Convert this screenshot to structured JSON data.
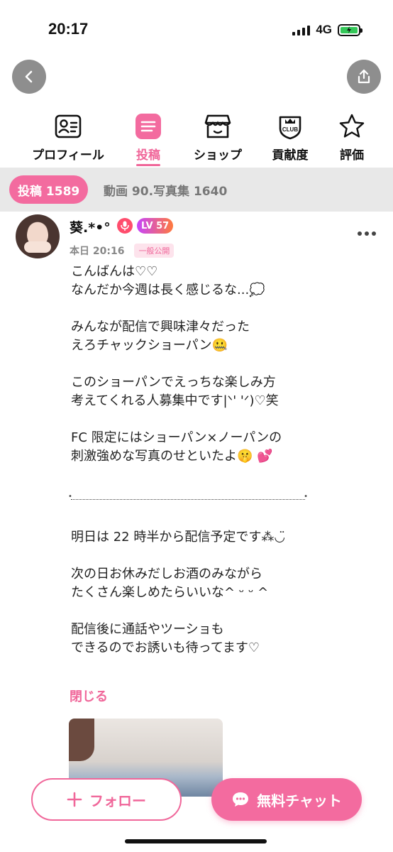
{
  "status_bar": {
    "time": "20:17",
    "network": "4G"
  },
  "tabs": [
    {
      "label": "プロフィール",
      "icon": "profile-card-icon"
    },
    {
      "label": "投稿",
      "icon": "posts-icon",
      "active": true
    },
    {
      "label": "ショップ",
      "icon": "shop-icon"
    },
    {
      "label": "貢献度",
      "icon": "club-crown-icon"
    },
    {
      "label": "評価",
      "icon": "star-icon"
    }
  ],
  "filter": {
    "active_label": "投稿 1589",
    "other_label": "動画 90.写真集 1640"
  },
  "post": {
    "user_name": "葵.*•°",
    "level": "LV 57",
    "time": "本日 20:16",
    "visibility": "一般公開",
    "paragraphs": [
      "こんばんは♡♡\nなんだか今週は長く感じるな...💭",
      "みんなが配信で興味津々だった\nえろチャックショーパン🤐",
      "このショーパンでえっちな楽しみ方\n考えてくれる人募集中です|ᐠ' 'ᐟ)♡笑",
      "FC 限定にはショーパン×ノーパンの\n刺激強めな写真のせといたよ🤫 💕"
    ],
    "paragraphs2": [
      "明日は 22 時半から配信予定です⁂◡̈",
      "次の日お休みだしお酒のみながら\nたくさん楽しめたらいいな^ ᵕ ᵕ ^",
      "配信後に通話やツーショも\nできるのでお誘いも待ってます♡"
    ],
    "close_label": "閉じる"
  },
  "actions": {
    "follow_label": "フォロー",
    "chat_label": "無料チャット"
  },
  "colors": {
    "accent": "#f0679a",
    "pill": "#f36b9f"
  }
}
